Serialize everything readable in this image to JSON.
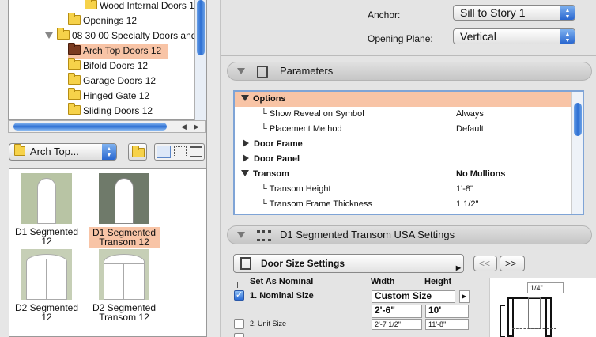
{
  "tree": {
    "items": [
      {
        "label": "Wood Internal Doors 12"
      },
      {
        "label": "Openings 12"
      },
      {
        "label": "08 30 00 Specialty Doors and"
      },
      {
        "label": "Arch Top Doors 12"
      },
      {
        "label": "Bifold Doors 12"
      },
      {
        "label": "Garage Doors 12"
      },
      {
        "label": "Hinged Gate 12"
      },
      {
        "label": "Sliding Doors 12"
      }
    ]
  },
  "library_select": {
    "value": "Arch Top..."
  },
  "thumbnails": [
    {
      "label1": "D1 Segmented",
      "label2": "12"
    },
    {
      "label1": "D1 Segmented",
      "label2": "Transom 12"
    },
    {
      "label1": "D2 Segmented",
      "label2": "12"
    },
    {
      "label1": "D2 Segmented",
      "label2": "Transom 12"
    }
  ],
  "anchor": {
    "label": "Anchor:",
    "value": "Sill to Story 1"
  },
  "opening_plane": {
    "label": "Opening Plane:",
    "value": "Vertical"
  },
  "parameters_section": {
    "title": "Parameters"
  },
  "params": [
    {
      "name": "Options",
      "value": ""
    },
    {
      "name": "Show Reveal on Symbol",
      "value": "Always"
    },
    {
      "name": "Placement Method",
      "value": "Default"
    },
    {
      "name": "Door Frame",
      "value": ""
    },
    {
      "name": "Door Panel",
      "value": ""
    },
    {
      "name": "Transom",
      "value": "No Mullions"
    },
    {
      "name": "Transom Height",
      "value": "1'-8\""
    },
    {
      "name": "Transom Frame Thickness",
      "value": "1 1/2\""
    }
  ],
  "settings_section": {
    "title": "D1 Segmented Transom USA Settings"
  },
  "door_size_select": {
    "value": "Door Size Settings"
  },
  "nav": {
    "prev": "<<",
    "next": ">>"
  },
  "size_table": {
    "set_as_nominal": "Set As Nominal",
    "width_header": "Width",
    "height_header": "Height",
    "nominal_label": "1. Nominal Size",
    "custom_size": "Custom Size",
    "nominal_width": "2'-6\"",
    "nominal_height": "10'",
    "unit_label": "2. Unit Size",
    "unit_width": "2'-7 1/2\"",
    "unit_height": "11'-8\""
  },
  "preview": {
    "dimension": "1/4\""
  }
}
